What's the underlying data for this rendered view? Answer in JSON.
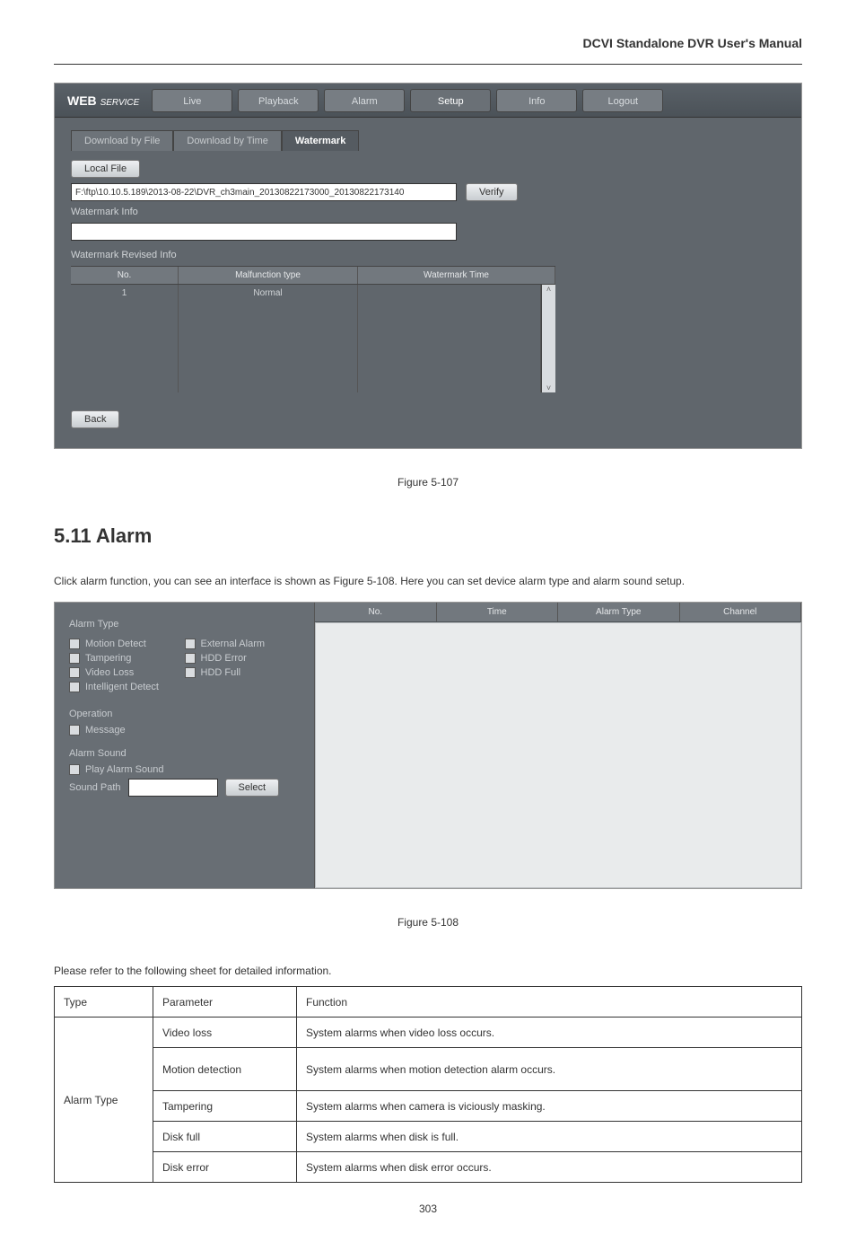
{
  "doc_title": "DCVI Standalone DVR User's Manual",
  "shot1": {
    "logo_web": "WEB",
    "logo_svc": "SERVICE",
    "nav": {
      "live": "Live",
      "playback": "Playback",
      "alarm": "Alarm",
      "setup": "Setup",
      "info": "Info",
      "logout": "Logout"
    },
    "subtabs": {
      "file": "Download by File",
      "time": "Download by Time",
      "watermark": "Watermark"
    },
    "local_file_btn": "Local File",
    "path_value": "F:\\ftp\\10.10.5.189\\2013-08-22\\DVR_ch3main_20130822173000_20130822173140",
    "verify_btn": "Verify",
    "watermark_info_lbl": "Watermark Info",
    "watermark_rev_lbl": "Watermark Revised Info",
    "cols": {
      "no": "No.",
      "malf": "Malfunction type",
      "wtime": "Watermark Time"
    },
    "row1": {
      "no": "1",
      "malf": "Normal",
      "wtime": ""
    },
    "back_btn": "Back"
  },
  "caption1": "Figure 5-107",
  "section_title": "5.11  Alarm",
  "alarm_intro": "Click alarm function, you can see an interface is shown as Figure 5-108. Here you can set device alarm type and alarm sound setup.",
  "shot2": {
    "grp_alarm_type": "Alarm Type",
    "items": {
      "motion": "Motion Detect",
      "external": "External Alarm",
      "tampering": "Tampering",
      "hdd_error": "HDD Error",
      "video_loss": "Video Loss",
      "hdd_full": "HDD Full",
      "intelligent": "Intelligent Detect"
    },
    "grp_operation": "Operation",
    "message": "Message",
    "grp_sound": "Alarm Sound",
    "play_sound": "Play Alarm Sound",
    "sound_path_lbl": "Sound Path",
    "select_btn": "Select",
    "rhead": {
      "no": "No.",
      "time": "Time",
      "atype": "Alarm Type",
      "channel": "Channel"
    }
  },
  "caption2": "Figure 5-108",
  "param_intro": "Please refer to the following sheet for detailed information.",
  "param_tbl": {
    "h_type": "Type",
    "h_param": "Parameter",
    "h_func": "Function",
    "rows": [
      {
        "type": "Alarm Type",
        "param": "Video loss",
        "func": "System alarms when video loss occurs.",
        "rowspan": 7
      },
      {
        "param": "Motion detection",
        "func": "System alarms when motion detection alarm occurs."
      },
      {
        "param": "Tampering",
        "func": "System alarms when camera is viciously masking."
      },
      {
        "param": "Disk full",
        "func": "System alarms when disk is full."
      },
      {
        "param": "Disk error",
        "func": "System alarms when disk error occurs."
      }
    ]
  },
  "page_no": "303"
}
